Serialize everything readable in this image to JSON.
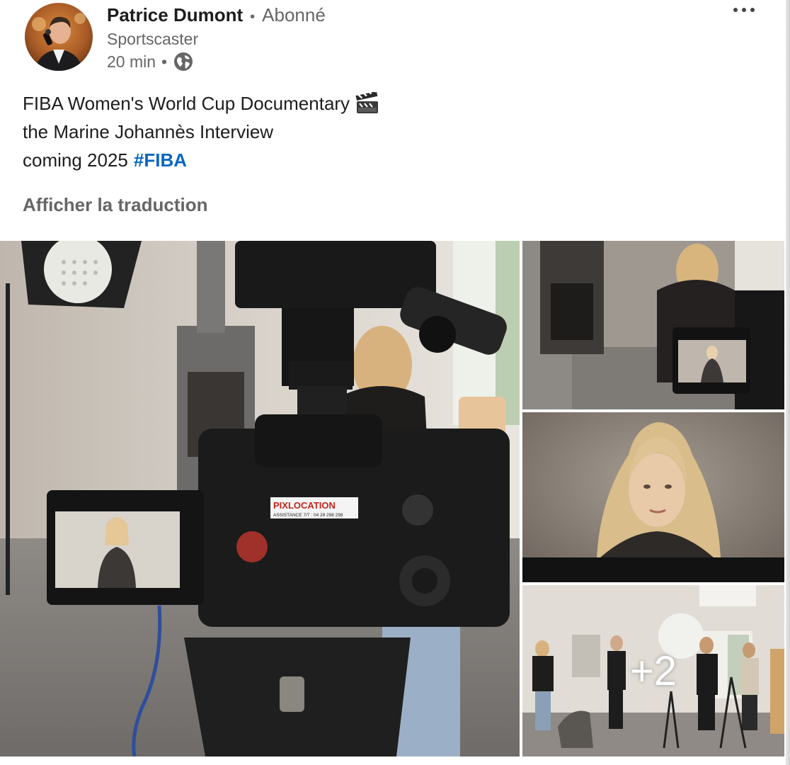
{
  "author": {
    "name": "Patrice Dumont",
    "relation": "Abonné",
    "title": "Sportscaster",
    "time": "20 min",
    "separator": "•",
    "visibility_icon": "globe-icon"
  },
  "post": {
    "line1": "FIBA Women's World Cup Documentary",
    "line1_emoji": "clapper-board-icon",
    "line2": "the Marine Johannès Interview",
    "line3_text": "coming 2025",
    "hashtag": "#FIBA",
    "translate_label": "Afficher la traduction"
  },
  "images": {
    "main_camera_label": "PIXLOCATION",
    "main_camera_phone": "ASSISTANCE 7/7 : 04 28 298 298",
    "extra_count": "+2"
  },
  "colors": {
    "hashtag": "#0a66c2",
    "muted": "#666666"
  }
}
